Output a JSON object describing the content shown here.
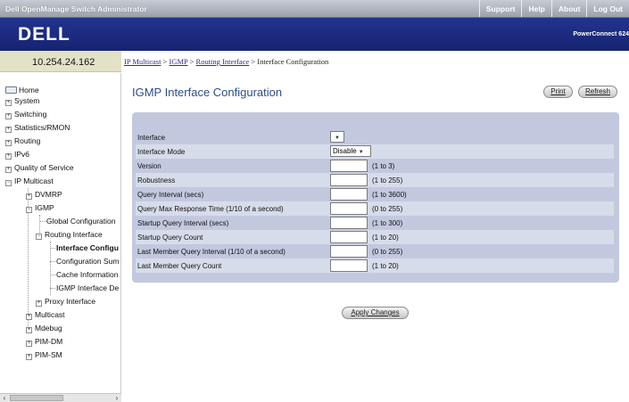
{
  "header": {
    "app_title": "Dell OpenManage Switch Administrator",
    "links": [
      "Support",
      "Help",
      "About",
      "Log Out"
    ],
    "logo": "DELL",
    "model": "PowerConnect 624"
  },
  "sidebar": {
    "ip_address": "10.254.24.162",
    "tree": {
      "home": "Home",
      "system": "System",
      "switching": "Switching",
      "statistics": "Statistics/RMON",
      "routing": "Routing",
      "ipv6": "IPv6",
      "qos": "Quality of Service",
      "ip_multicast": "IP Multicast",
      "dvmrp": "DVMRP",
      "igmp": "IGMP",
      "global_config": "Global Configuration",
      "routing_interface": "Routing Interface",
      "interface_config": "Interface Configu",
      "config_summary": "Configuration Sum",
      "cache_info": "Cache Information",
      "igmp_interface_detail": "IGMP Interface De",
      "proxy_interface": "Proxy Interface",
      "multicast": "Multicast",
      "mdebug": "Mdebug",
      "pim_dm": "PIM-DM",
      "pim_sm": "PIM-SM"
    }
  },
  "breadcrumb": {
    "item1": "IP Multicast",
    "item2": "IGMP",
    "item3": "Routing Interface",
    "current": "Interface Configuration",
    "sep": ">"
  },
  "page": {
    "title": "IGMP Interface Configuration",
    "print_label": "Print",
    "refresh_label": "Refresh",
    "apply_label": "Apply Changes"
  },
  "form": {
    "interface_label": "Interface",
    "interface_value": "",
    "mode_label": "Interface Mode",
    "mode_value": "Disable",
    "version_label": "Version",
    "version_range": "(1 to 3)",
    "robustness_label": "Robustness",
    "robustness_range": "(1 to 255)",
    "query_interval_label": "Query Interval (secs)",
    "query_interval_range": "(1 to 3600)",
    "query_max_resp_label": "Query Max Response Time (1/10 of a second)",
    "query_max_resp_range": "(0 to 255)",
    "startup_qi_label": "Startup Query Interval (secs)",
    "startup_qi_range": "(1 to 300)",
    "startup_qc_label": "Startup Query Count",
    "startup_qc_range": "(1 to 20)",
    "lmq_interval_label": "Last Member Query Interval (1/10 of a second)",
    "lmq_interval_range": "(0 to 255)",
    "lmq_count_label": "Last Member Query Count",
    "lmq_count_range": "(1 to 20)"
  }
}
